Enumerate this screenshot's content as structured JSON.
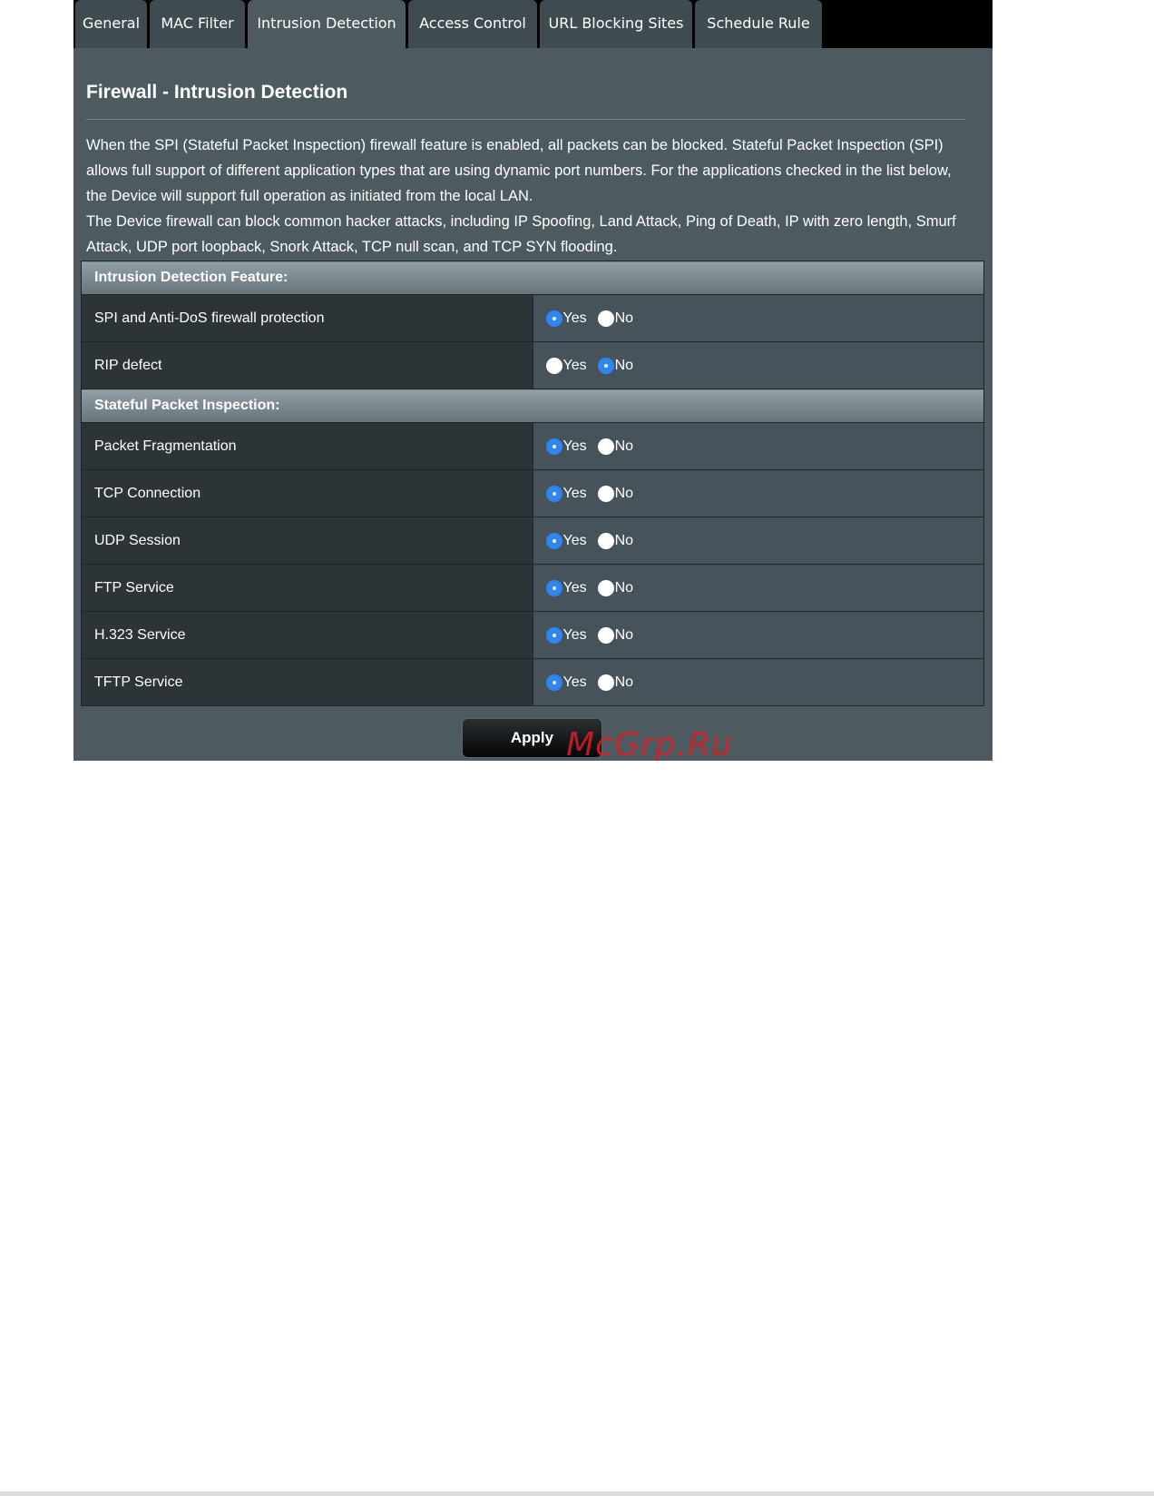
{
  "tabs": [
    {
      "label": "General",
      "active": false
    },
    {
      "label": "MAC Filter",
      "active": false
    },
    {
      "label": "Intrusion Detection",
      "active": true
    },
    {
      "label": "Access Control",
      "active": false
    },
    {
      "label": "URL Blocking Sites",
      "active": false
    },
    {
      "label": "Schedule Rule",
      "active": false
    }
  ],
  "page": {
    "title": "Firewall - Intrusion Detection",
    "description_1": "When the SPI (Stateful Packet Inspection) firewall feature is enabled, all packets can be blocked. Stateful Packet Inspection (SPI) allows full support of different application types that are using dynamic port numbers.  For the applications checked in the list below, the Device will support full operation as initiated from the local LAN.",
    "description_2": "The Device firewall can block common hacker attacks, including IP Spoofing, Land Attack, Ping of Death, IP with zero length, Smurf Attack, UDP port loopback, Snork Attack, TCP null scan, and TCP SYN flooding."
  },
  "radio_labels": {
    "yes": "Yes",
    "no": "No"
  },
  "sections": [
    {
      "header": "Intrusion Detection Feature:",
      "rows": [
        {
          "label": "SPI and Anti-DoS firewall protection",
          "value": "Yes"
        },
        {
          "label": "RIP defect",
          "value": "No"
        }
      ]
    },
    {
      "header": "Stateful Packet Inspection:",
      "rows": [
        {
          "label": "Packet Fragmentation",
          "value": "Yes"
        },
        {
          "label": "TCP Connection",
          "value": "Yes"
        },
        {
          "label": "UDP Session",
          "value": "Yes"
        },
        {
          "label": "FTP Service",
          "value": "Yes"
        },
        {
          "label": "H.323 Service",
          "value": "Yes"
        },
        {
          "label": "TFTP Service",
          "value": "Yes"
        }
      ]
    }
  ],
  "apply_label": "Apply",
  "watermark": "McGrp.Ru",
  "colors": {
    "radio_checked": "#2e86f2",
    "panel_background": "#4d5a5f",
    "label_cell": "#2c3438",
    "value_cell": "#46535a",
    "watermark": "#d71e28"
  }
}
